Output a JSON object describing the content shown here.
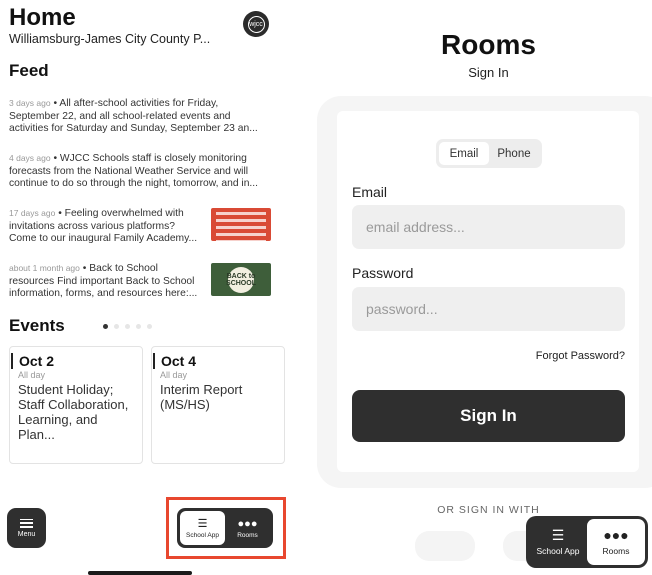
{
  "home": {
    "title": "Home",
    "district": "Williamsburg-James City County P...",
    "logo_text": "wjcc",
    "feed_title": "Feed",
    "feed": [
      {
        "ago": "3 days ago",
        "text": "All after-school activities for Friday, September 22, and all school-related events and activities for Saturday and Sunday, September 23 an..."
      },
      {
        "ago": "4 days ago",
        "text": "WJCC Schools staff is closely monitoring forecasts from the National Weather Service and will continue to do so through the night, tomorrow, and in..."
      },
      {
        "ago": "17 days ago",
        "text": "Feeling overwhelmed with invitations across various platforms? Come to our inaugural Family Academy...",
        "thumb": "red-flyer"
      },
      {
        "ago": "about 1 month ago",
        "text": "Back to School resources Find important Back to School information, forms, and resources here:...",
        "thumb": "back-to-school",
        "thumb_text": "BACK to SCHOOL"
      }
    ],
    "events_title": "Events",
    "events": [
      {
        "date": "Oct 2",
        "when": "All day",
        "name": "Student Holiday; Staff Collaboration, Learning, and Plan..."
      },
      {
        "date": "Oct 4",
        "when": "All day",
        "name": "Interim Report (MS/HS)"
      }
    ],
    "menu_label": "Menu",
    "nav": [
      {
        "label": "School App",
        "icon": "stack-icon",
        "active": true
      },
      {
        "label": "Rooms",
        "icon": "people-icon",
        "active": false
      }
    ],
    "highlight_color": "#e8472f"
  },
  "rooms": {
    "title": "Rooms",
    "subtitle": "Sign In",
    "toggle": [
      "Email",
      "Phone"
    ],
    "email_label": "Email",
    "email_placeholder": "email address...",
    "password_label": "Password",
    "password_placeholder": "password...",
    "forgot": "Forgot Password?",
    "signin_button": "Sign In",
    "or_text": "OR SIGN IN WITH",
    "nav": [
      {
        "label": "School App",
        "icon": "stack-icon",
        "active": false
      },
      {
        "label": "Rooms",
        "icon": "people-icon",
        "active": true
      }
    ]
  },
  "colors": {
    "dark": "#2f2f2f",
    "accent_red": "#e8472f",
    "field_bg": "#efefef"
  }
}
